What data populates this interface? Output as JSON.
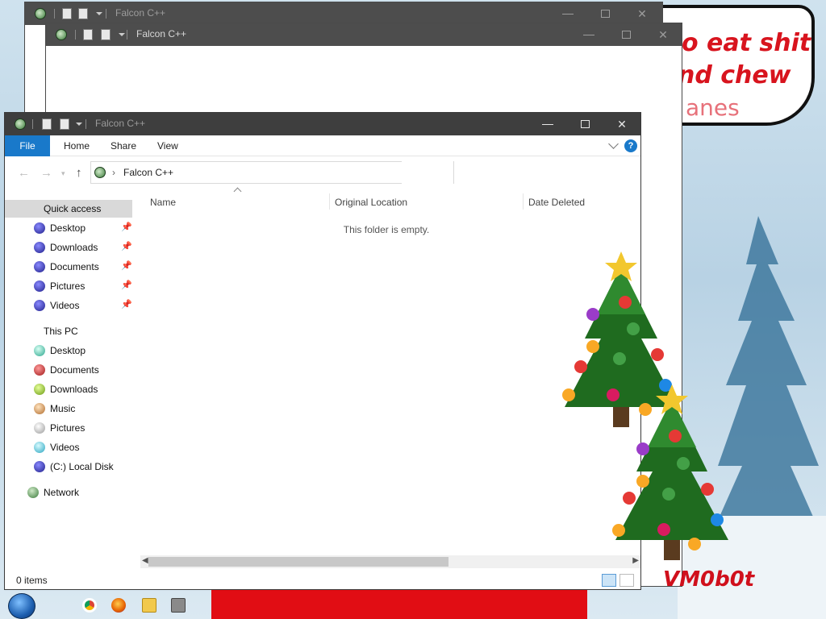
{
  "desktop": {
    "speech_lines": [
      "o eat shit",
      "nd chew",
      "anes"
    ],
    "vm_text": "VM0b0t"
  },
  "windows": {
    "back1": {
      "title": "Falcon C++"
    },
    "back2": {
      "title": "Falcon C++"
    },
    "main": {
      "title": "Falcon C++",
      "ribbon": {
        "file": "File",
        "home": "Home",
        "share": "Share",
        "view": "View",
        "help": "?"
      },
      "address": {
        "location": "Falcon C++"
      },
      "sidebar": {
        "quick_access": "Quick access",
        "quick_items": [
          "Desktop",
          "Downloads",
          "Documents",
          "Pictures",
          "Videos"
        ],
        "this_pc": "This PC",
        "pc_items": [
          "Desktop",
          "Documents",
          "Downloads",
          "Music",
          "Pictures",
          "Videos",
          "(C:) Local Disk"
        ],
        "network": "Network"
      },
      "columns": {
        "name": "Name",
        "original_location": "Original Location",
        "date_deleted": "Date Deleted"
      },
      "empty_message": "This folder is empty.",
      "status": "0 items"
    }
  },
  "colors": {
    "accent": "#1979ca",
    "titlebar_active": "#3e3e3e",
    "speech_red": "#d8141e"
  }
}
